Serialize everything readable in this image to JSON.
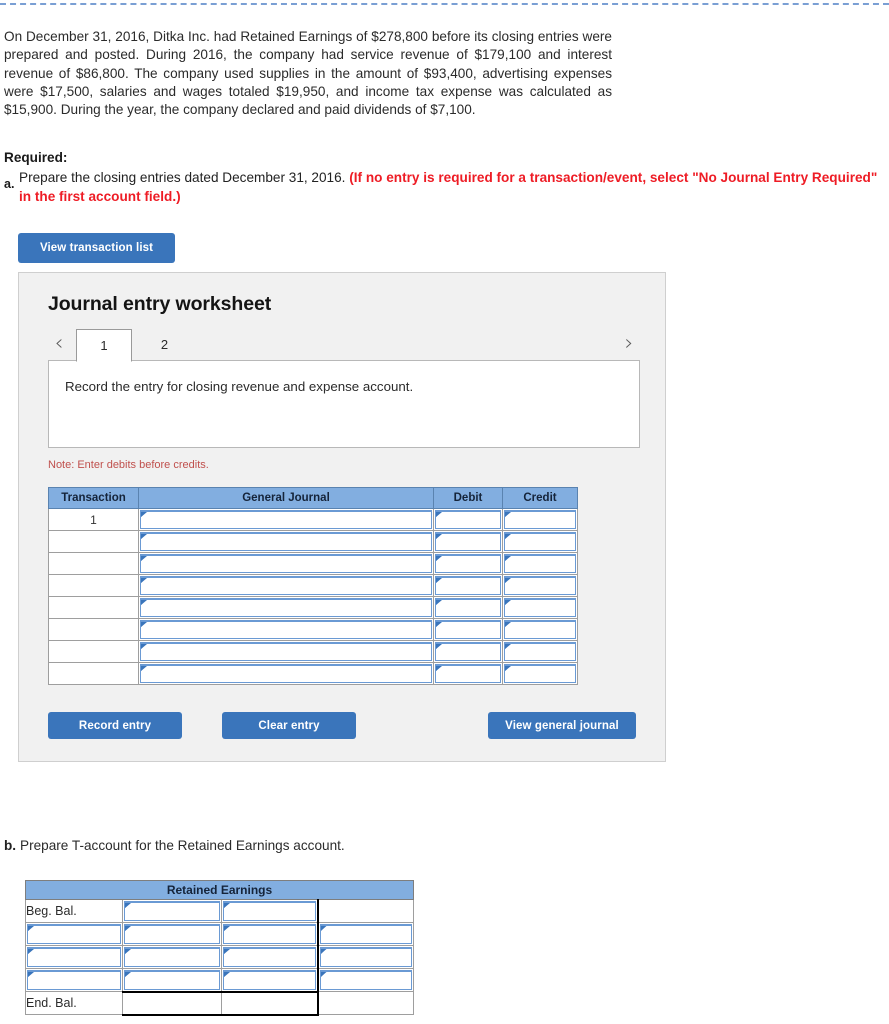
{
  "problem": {
    "text": "On December 31, 2016, Ditka Inc. had Retained Earnings of $278,800 before its closing entries were prepared and posted. During 2016, the company had service revenue of $179,100 and interest revenue of $86,800. The company used supplies in the amount of $93,400, advertising expenses were $17,500, salaries and wages totaled $19,950, and income tax expense was calculated as $15,900. During the year, the company declared and paid dividends of $7,100."
  },
  "required": {
    "label": "Required:",
    "part_a_letter": "a.",
    "part_a_text": "Prepare the closing entries dated December 31, 2016. ",
    "part_a_red": "(If no entry is required for a transaction/event, select \"No Journal Entry Required\" in the first account field.)"
  },
  "toolbar": {
    "view_transaction_list": "View transaction list"
  },
  "worksheet": {
    "title": "Journal entry worksheet",
    "prev_chevron": "‹",
    "next_chevron": "›",
    "tabs": [
      {
        "label": "1",
        "active": true
      },
      {
        "label": "2",
        "active": false
      }
    ],
    "description": "Record the entry for closing revenue and expense account.",
    "note": "Note: Enter debits before credits.",
    "table": {
      "headers": [
        "Transaction",
        "General Journal",
        "Debit",
        "Credit"
      ],
      "rows": [
        {
          "transaction": "1",
          "general_journal": "",
          "debit": "",
          "credit": ""
        },
        {
          "transaction": "",
          "general_journal": "",
          "debit": "",
          "credit": ""
        },
        {
          "transaction": "",
          "general_journal": "",
          "debit": "",
          "credit": ""
        },
        {
          "transaction": "",
          "general_journal": "",
          "debit": "",
          "credit": ""
        },
        {
          "transaction": "",
          "general_journal": "",
          "debit": "",
          "credit": ""
        },
        {
          "transaction": "",
          "general_journal": "",
          "debit": "",
          "credit": ""
        },
        {
          "transaction": "",
          "general_journal": "",
          "debit": "",
          "credit": ""
        },
        {
          "transaction": "",
          "general_journal": "",
          "debit": "",
          "credit": ""
        }
      ]
    },
    "buttons": {
      "record_entry": "Record entry",
      "clear_entry": "Clear entry",
      "view_general_journal": "View general journal"
    }
  },
  "part_b": {
    "letter": "b.",
    "text": "Prepare T-account for the Retained Earnings account.",
    "t_account": {
      "title": "Retained Earnings",
      "rows": [
        {
          "label": "Beg. Bal.",
          "debit": "",
          "credit": "",
          "extra": ""
        },
        {
          "label": "",
          "debit": "",
          "credit": "",
          "extra": ""
        },
        {
          "label": "",
          "debit": "",
          "credit": "",
          "extra": ""
        },
        {
          "label": "",
          "debit": "",
          "credit": "",
          "extra": ""
        },
        {
          "label": "End. Bal.",
          "debit": "",
          "credit": "",
          "extra": ""
        }
      ]
    }
  },
  "colors": {
    "button_blue": "#3a75bb",
    "header_blue": "#82aee0",
    "note_red": "#c0504d",
    "alert_red": "#ee1c25",
    "card_bg": "#f1f1f1"
  }
}
